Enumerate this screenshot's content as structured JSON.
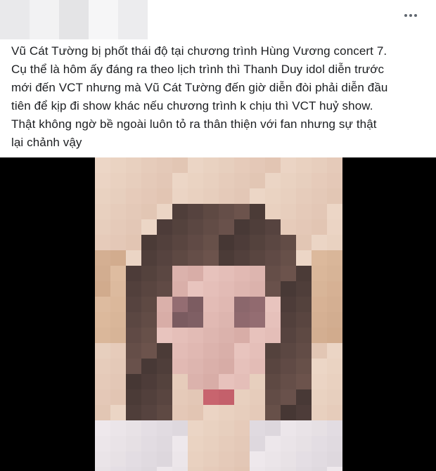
{
  "post": {
    "text": "Vũ Cát Tường bị phốt thái độ tại chương trình Hùng Vương concert 7.\nCụ thể là hôm ấy đáng ra  theo lịch trình thì Thanh Duy idol diễn trước\nmới đến VCT nhưng mà Vũ Cát Tường đến giờ diễn đòi phải diễn đầu\ntiên để kịp đi show khác nếu chương trình k chịu thì VCT huỷ show.\nThật không ngờ bề ngoài luôn tỏ ra thân thiện với fan nhưng sự thật\nlại chảnh vậy",
    "more_icon": "more-horizontal-icon"
  },
  "colors": {
    "text": "#1c1e21",
    "media_background": "#000000",
    "icon": "#606770"
  }
}
